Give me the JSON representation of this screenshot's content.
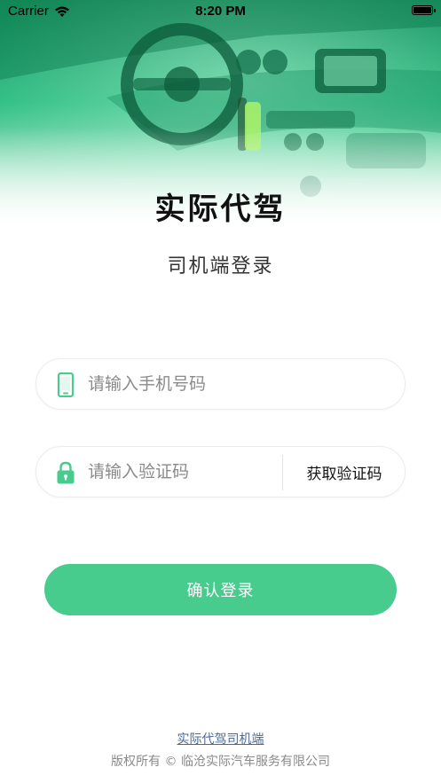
{
  "status_bar": {
    "carrier": "Carrier",
    "time": "8:20 PM"
  },
  "header": {
    "title": "实际代驾",
    "subtitle": "司机端登录"
  },
  "form": {
    "phone": {
      "placeholder": "请输入手机号码",
      "value": "",
      "icon": "phone-icon"
    },
    "code": {
      "placeholder": "请输入验证码",
      "value": "",
      "icon": "lock-icon",
      "get_code_label": "获取验证码"
    },
    "submit_label": "确认登录"
  },
  "footer": {
    "link_text": "实际代驾司机端",
    "copyright": "版权所有 © 临沧实际汽车服务有限公司"
  },
  "colors": {
    "accent": "#47cc8e",
    "hero_green": "#1fae74"
  }
}
